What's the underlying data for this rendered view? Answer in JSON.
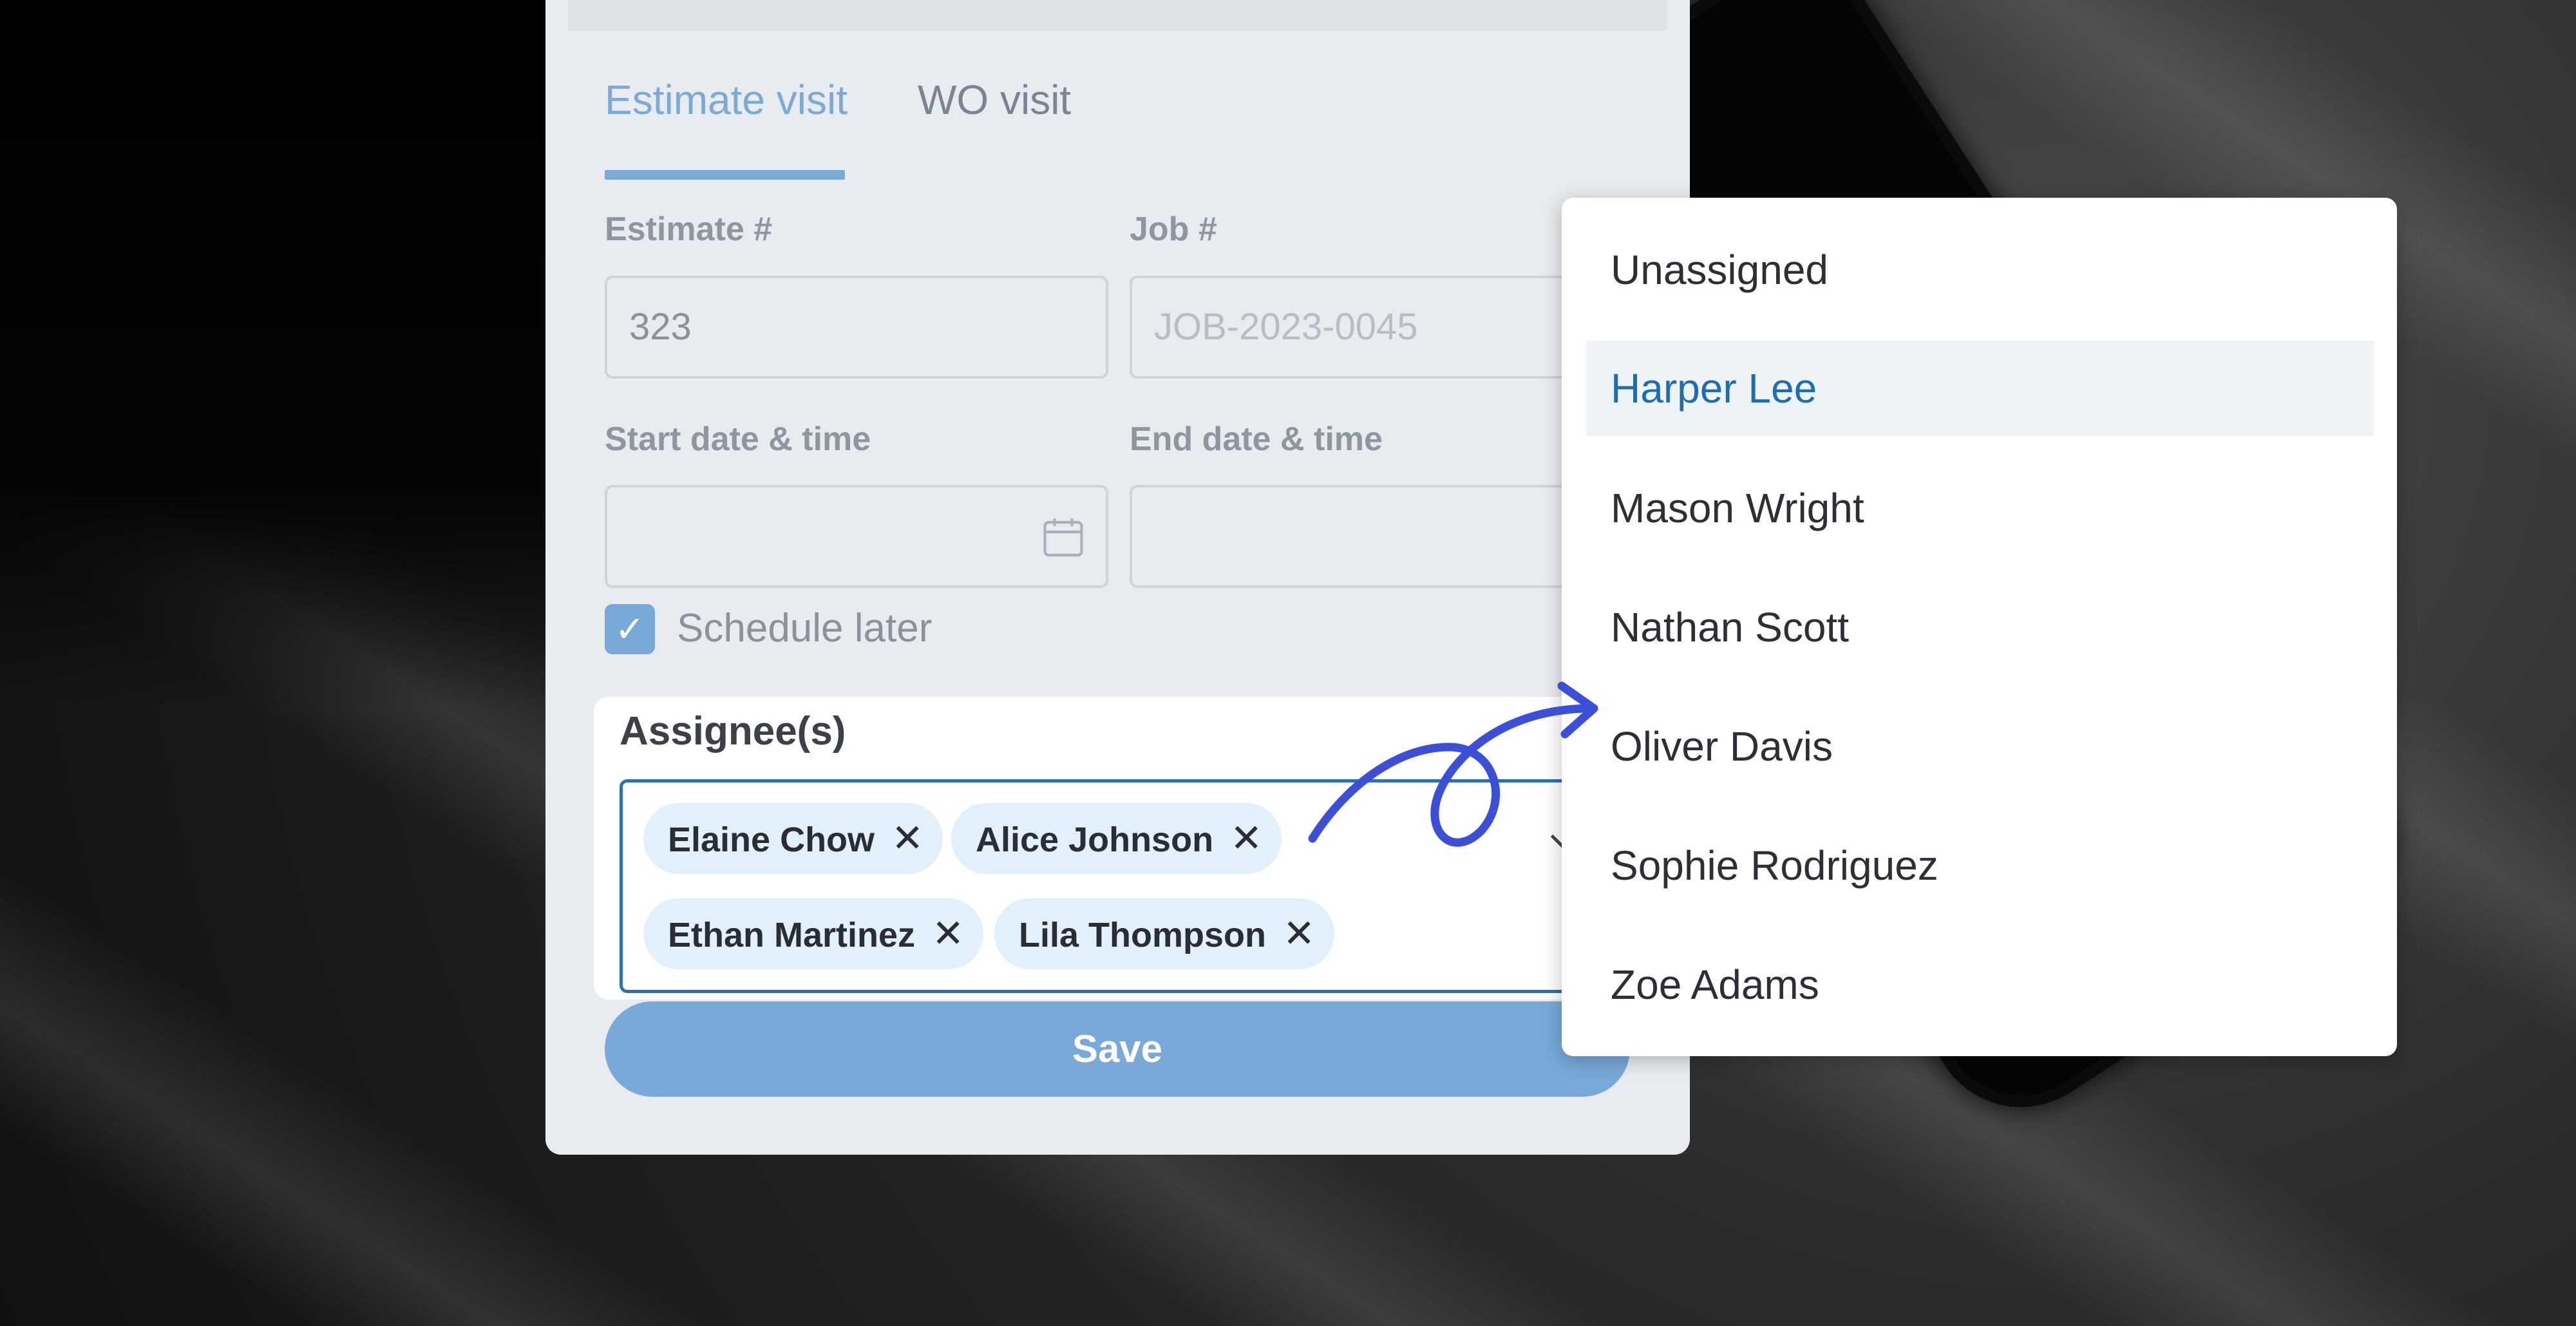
{
  "tabs": [
    {
      "label": "Estimate visit",
      "active": true
    },
    {
      "label": "WO visit",
      "active": false
    }
  ],
  "fields": {
    "estimate_label": "Estimate #",
    "estimate_value": "323",
    "job_label": "Job #",
    "job_placeholder": "JOB-2023-0045",
    "start_label": "Start date & time",
    "end_label": "End date & time"
  },
  "schedule_later": {
    "label": "Schedule later",
    "checked": true
  },
  "assignees": {
    "label": "Assignee(s)",
    "chips": [
      "Elaine Chow",
      "Alice Johnson",
      "Ethan Martinez",
      "Lila Thompson"
    ]
  },
  "save_label": "Save",
  "dropdown": {
    "options": [
      "Unassigned",
      "Harper Lee",
      "Mason Wright",
      "Nathan Scott",
      "Oliver Davis",
      "Sophie Rodriguez",
      "Zoe Adams"
    ],
    "highlighted": "Harper Lee"
  },
  "colors": {
    "accent": "#78a9d8",
    "selected_text": "#1f6db1",
    "annotation_arrow": "#3b4fd8"
  },
  "icons": [
    "calendar-icon",
    "check-icon",
    "close-icon",
    "chevron-down-icon",
    "curly-arrow-icon"
  ]
}
